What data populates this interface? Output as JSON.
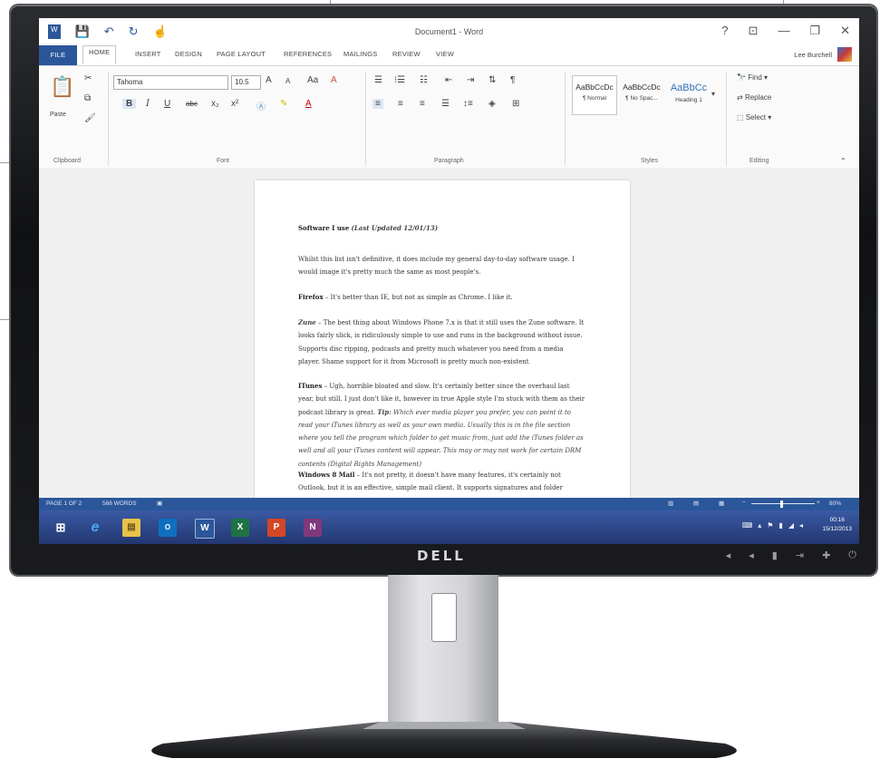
{
  "window": {
    "title": "Document1 - Word",
    "user": "Lee Burchell",
    "controls": [
      "?",
      "⊡",
      "—",
      "❐",
      "✕"
    ]
  },
  "tabs": [
    "FILE",
    "HOME",
    "INSERT",
    "DESIGN",
    "PAGE LAYOUT",
    "REFERENCES",
    "MAILINGS",
    "REVIEW",
    "VIEW"
  ],
  "ribbon": {
    "clipboard": {
      "paste": "Paste",
      "label": "Clipboard"
    },
    "font": {
      "name": "Tahoma",
      "size": "10.5",
      "label": "Font",
      "buttons": [
        "B",
        "I",
        "U",
        "abc",
        "x₂",
        "x²",
        "A",
        "A",
        "Aa",
        "A"
      ]
    },
    "paragraph": {
      "label": "Paragraph"
    },
    "styles": {
      "label": "Styles",
      "items": [
        {
          "sample": "AaBbCcDc",
          "name": "¶ Normal"
        },
        {
          "sample": "AaBbCcDc",
          "name": "¶ No Spac..."
        },
        {
          "sample": "AaBbCc",
          "name": "Heading 1"
        }
      ]
    },
    "editing": {
      "label": "Editing",
      "find": "Find",
      "replace": "Replace",
      "select": "Select"
    }
  },
  "document": {
    "heading": "Software I use",
    "heading_date": "(Last Updated 12/01/13)",
    "intro": "Whilst this list isn't definitive, it does include my general day-to-day software usage. I would image it's pretty much the same as most people's.",
    "firefox_name": "Firefox",
    "firefox": " – It's better than IE, but not as simple as Chrome. I like it.",
    "zune_name": "Zune",
    "zune": " – The best thing about Windows Phone 7.x is that it still uses the Zune software. It looks fairly slick, is ridiculously simple to use and runs in the background without issue. Supports disc ripping, podcasts and pretty much whatever you need from a media player. Shame support for it from Microsoft is pretty much non-existent",
    "itunes_name": "ITunes",
    "itunes": " – Ugh, horrible bloated and slow. It's certainly better since the overhaul last year, but still. I just don't like it, however in true Apple style I'm stuck with them as their podcast library is great.",
    "tip_label": "Tip:",
    "tip": " Which ever media player you prefer, you can point it to read your iTunes library as well as your own media. Usually this is in the file section where you tell the program which folder to get music from, just add the iTunes folder as well and all your iTunes content will appear. This may or may not work for certain DRM contents (Digital Rights Management)",
    "mail_name": "Windows 8 Mail",
    "mail": " – It's not pretty, it doesn't have many features, it's certainly not Outlook, but it is an effective, simple mail client. It supports signatures and folder creation. For a standard"
  },
  "statusbar": {
    "page": "PAGE 1 OF 2",
    "words": "566 WORDS",
    "zoom": "80%"
  },
  "taskbar": {
    "apps": [
      "IE",
      "Explorer",
      "Outlook",
      "Word",
      "Excel",
      "PowerPoint",
      "OneNote"
    ],
    "time": "00:16",
    "date": "15/12/2013"
  },
  "monitor": {
    "brand": "DELL"
  }
}
